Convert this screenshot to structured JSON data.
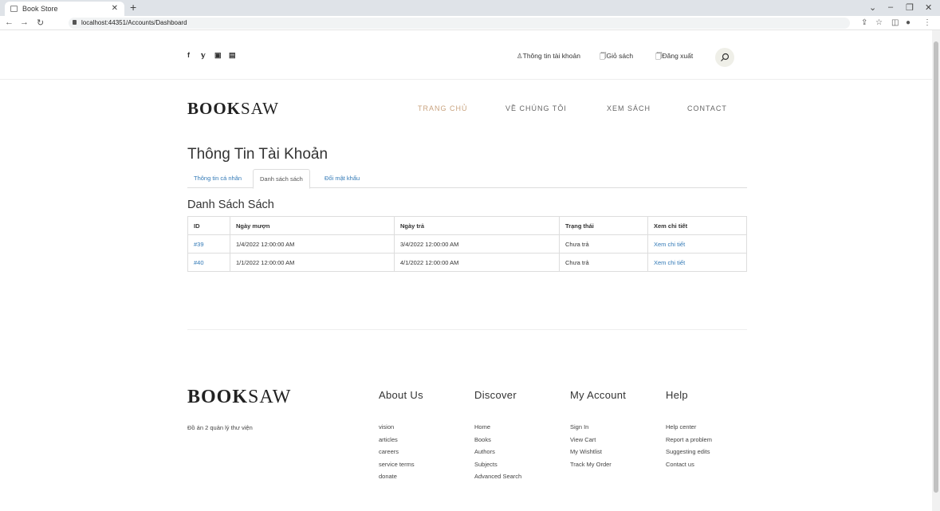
{
  "browser": {
    "tab_title": "Book Store",
    "url": "localhost:44351/Accounts/Dashboard"
  },
  "topbar": {
    "social_icons": [
      "facebook-icon",
      "twitter-icon",
      "youtube-icon",
      "linkedin-icon"
    ],
    "account_link": "Thông tin tài khoản",
    "cart_link": "Giỏ sách",
    "logout_link": "Đăng xuất"
  },
  "logo": {
    "bold": "BOOK",
    "light": "SAW"
  },
  "mainnav": {
    "home": "TRANG CHỦ",
    "about": "VỀ CHÚNG TÔI",
    "books": "XEM SÁCH",
    "contact": "CONTACT"
  },
  "page": {
    "title": "Thông Tin Tài Khoản",
    "tabs": [
      "Thông tin cá nhân",
      "Danh sách sách",
      "Đổi mật khẩu"
    ],
    "active_tab": "Danh sách sách",
    "section_title": "Danh Sách Sách"
  },
  "table": {
    "headers": [
      "ID",
      "Ngày mượn",
      "Ngày trả",
      "Trạng thái",
      "Xem chi tiết"
    ],
    "rows": [
      {
        "id": "#39",
        "borrowed": "1/4/2022 12:00:00 AM",
        "returned": "3/4/2022 12:00:00 AM",
        "status": "Chưa trả",
        "detail": "Xem chi tiết"
      },
      {
        "id": "#40",
        "borrowed": "1/1/2022 12:00:00 AM",
        "returned": "4/1/2022 12:00:00 AM",
        "status": "Chưa trả",
        "detail": "Xem chi tiết"
      }
    ]
  },
  "footer": {
    "description": "Đồ án 2 quản lý thư viện",
    "columns": [
      {
        "heading": "About Us",
        "links": [
          "vision",
          "articles",
          "careers",
          "service terms",
          "donate"
        ]
      },
      {
        "heading": "Discover",
        "links": [
          "Home",
          "Books",
          "Authors",
          "Subjects",
          "Advanced Search"
        ]
      },
      {
        "heading": "My Account",
        "links": [
          "Sign In",
          "View Cart",
          "My Wishtlist",
          "Track My Order"
        ]
      },
      {
        "heading": "Help",
        "links": [
          "Help center",
          "Report a problem",
          "Suggesting edits",
          "Contact us"
        ]
      }
    ]
  },
  "colors": {
    "accent": "#c9a37f",
    "link": "#337ab7"
  }
}
